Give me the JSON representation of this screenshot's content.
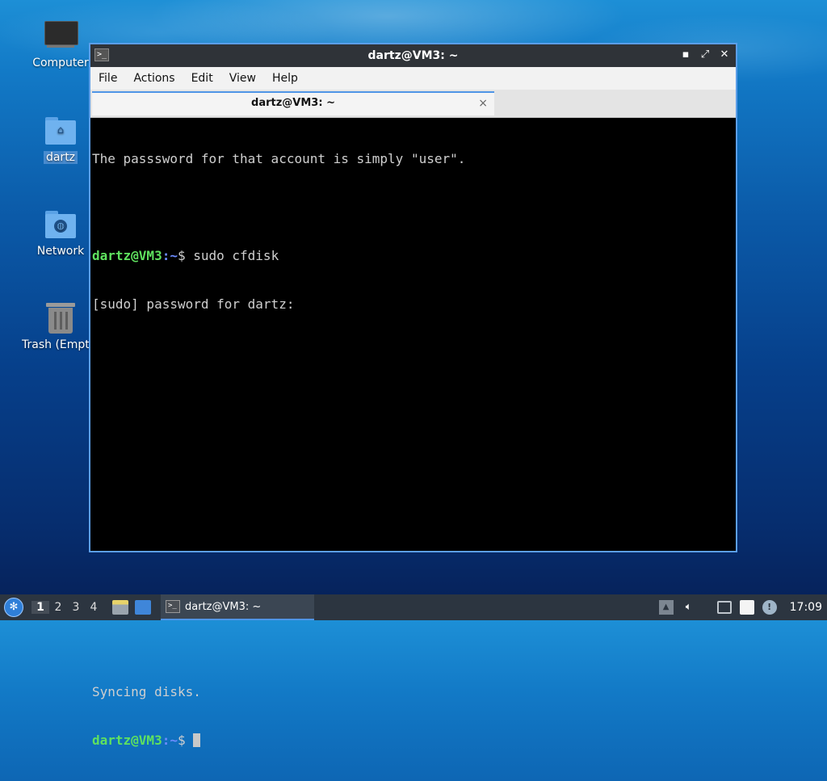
{
  "desktop": {
    "icons": [
      {
        "label": "Computer",
        "icon": "computer-icon"
      },
      {
        "label": "dartz",
        "icon": "home-folder-icon"
      },
      {
        "label": "Network",
        "icon": "network-folder-icon"
      },
      {
        "label": "Trash (Empty)",
        "icon": "trash-icon"
      }
    ]
  },
  "window": {
    "title": "dartz@VM3: ~",
    "menu": [
      "File",
      "Actions",
      "Edit",
      "View",
      "Help"
    ],
    "tab": {
      "label": "dartz@VM3: ~",
      "close": "×"
    }
  },
  "terminal": {
    "line1": "The passsword for that account is simply \"user\".",
    "prompt_user": "dartz@VM3",
    "prompt_path": ":~",
    "prompt_end": "$ ",
    "command1": "sudo cfdisk",
    "sudo_prompt": "[sudo] password for dartz:",
    "syncing": "Syncing disks."
  },
  "taskbar": {
    "workspaces": [
      "1",
      "2",
      "3",
      "4"
    ],
    "active_workspace": "1",
    "task_title": "dartz@VM3: ~",
    "clock": "17:09"
  },
  "colors": {
    "accent": "#4f95e6",
    "prompt_user": "#5fe15f",
    "prompt_path": "#6c8cff"
  }
}
